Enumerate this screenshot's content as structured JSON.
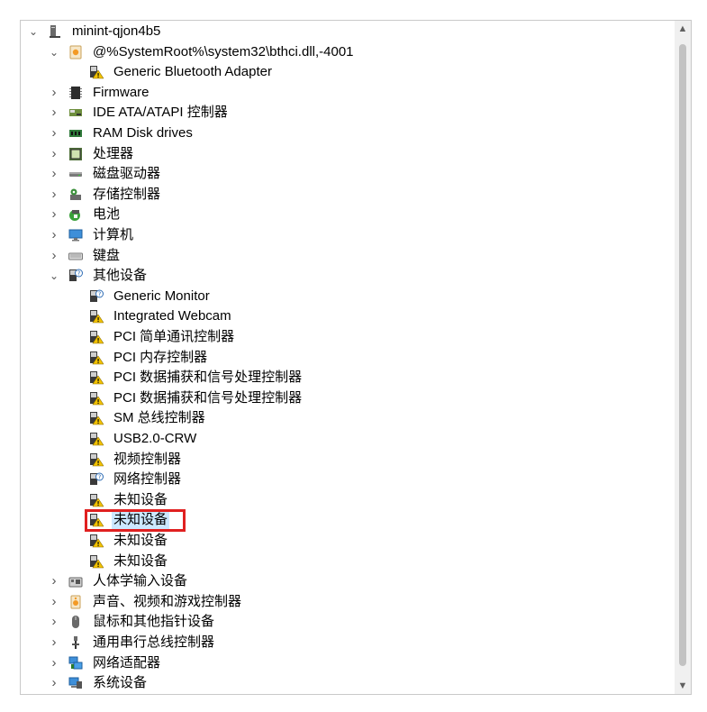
{
  "tree": [
    {
      "label": "minint-qjon4b5",
      "level": 0,
      "chevron": "expanded",
      "icon": "computer-root-icon"
    },
    {
      "label": "@%SystemRoot%\\system32\\bthci.dll,-4001",
      "level": 1,
      "chevron": "expanded",
      "icon": "bluetooth-category-icon"
    },
    {
      "label": "Generic Bluetooth Adapter",
      "level": 2,
      "chevron": "none",
      "icon": "device-warning-icon"
    },
    {
      "label": "Firmware",
      "level": 1,
      "chevron": "collapsed",
      "icon": "firmware-icon"
    },
    {
      "label": "IDE ATA/ATAPI 控制器",
      "level": 1,
      "chevron": "collapsed",
      "icon": "ide-controller-icon"
    },
    {
      "label": "RAM Disk drives",
      "level": 1,
      "chevron": "collapsed",
      "icon": "ram-disk-icon"
    },
    {
      "label": "处理器",
      "level": 1,
      "chevron": "collapsed",
      "icon": "processor-icon"
    },
    {
      "label": "磁盘驱动器",
      "level": 1,
      "chevron": "collapsed",
      "icon": "disk-drive-icon"
    },
    {
      "label": "存储控制器",
      "level": 1,
      "chevron": "collapsed",
      "icon": "storage-controller-icon"
    },
    {
      "label": "电池",
      "level": 1,
      "chevron": "collapsed",
      "icon": "battery-icon"
    },
    {
      "label": "计算机",
      "level": 1,
      "chevron": "collapsed",
      "icon": "monitor-icon"
    },
    {
      "label": "键盘",
      "level": 1,
      "chevron": "collapsed",
      "icon": "keyboard-icon"
    },
    {
      "label": "其他设备",
      "level": 1,
      "chevron": "expanded",
      "icon": "other-devices-icon"
    },
    {
      "label": "Generic Monitor",
      "level": 2,
      "chevron": "none",
      "icon": "device-question-icon"
    },
    {
      "label": "Integrated Webcam",
      "level": 2,
      "chevron": "none",
      "icon": "device-warning-icon"
    },
    {
      "label": "PCI 简单通讯控制器",
      "level": 2,
      "chevron": "none",
      "icon": "device-warning-icon"
    },
    {
      "label": "PCI 内存控制器",
      "level": 2,
      "chevron": "none",
      "icon": "device-warning-icon"
    },
    {
      "label": "PCI 数据捕获和信号处理控制器",
      "level": 2,
      "chevron": "none",
      "icon": "device-warning-icon"
    },
    {
      "label": "PCI 数据捕获和信号处理控制器",
      "level": 2,
      "chevron": "none",
      "icon": "device-warning-icon"
    },
    {
      "label": "SM 总线控制器",
      "level": 2,
      "chevron": "none",
      "icon": "device-warning-icon"
    },
    {
      "label": "USB2.0-CRW",
      "level": 2,
      "chevron": "none",
      "icon": "device-warning-icon"
    },
    {
      "label": "视频控制器",
      "level": 2,
      "chevron": "none",
      "icon": "device-warning-icon"
    },
    {
      "label": "网络控制器",
      "level": 2,
      "chevron": "none",
      "icon": "device-question-icon"
    },
    {
      "label": "未知设备",
      "level": 2,
      "chevron": "none",
      "icon": "device-warning-icon"
    },
    {
      "label": "未知设备",
      "level": 2,
      "chevron": "none",
      "icon": "device-warning-icon",
      "selected": true,
      "highlighted": true
    },
    {
      "label": "未知设备",
      "level": 2,
      "chevron": "none",
      "icon": "device-warning-icon"
    },
    {
      "label": "未知设备",
      "level": 2,
      "chevron": "none",
      "icon": "device-warning-icon"
    },
    {
      "label": "人体学输入设备",
      "level": 1,
      "chevron": "collapsed",
      "icon": "hid-icon"
    },
    {
      "label": "声音、视频和游戏控制器",
      "level": 1,
      "chevron": "collapsed",
      "icon": "sound-icon"
    },
    {
      "label": "鼠标和其他指针设备",
      "level": 1,
      "chevron": "collapsed",
      "icon": "mouse-icon"
    },
    {
      "label": "通用串行总线控制器",
      "level": 1,
      "chevron": "collapsed",
      "icon": "usb-icon"
    },
    {
      "label": "网络适配器",
      "level": 1,
      "chevron": "collapsed",
      "icon": "network-adapter-icon"
    },
    {
      "label": "系统设备",
      "level": 1,
      "chevron": "collapsed",
      "icon": "system-devices-icon"
    }
  ],
  "colors": {
    "selection": "#cce8ff",
    "highlight_border": "#e02020",
    "warning": "#f2c200"
  }
}
